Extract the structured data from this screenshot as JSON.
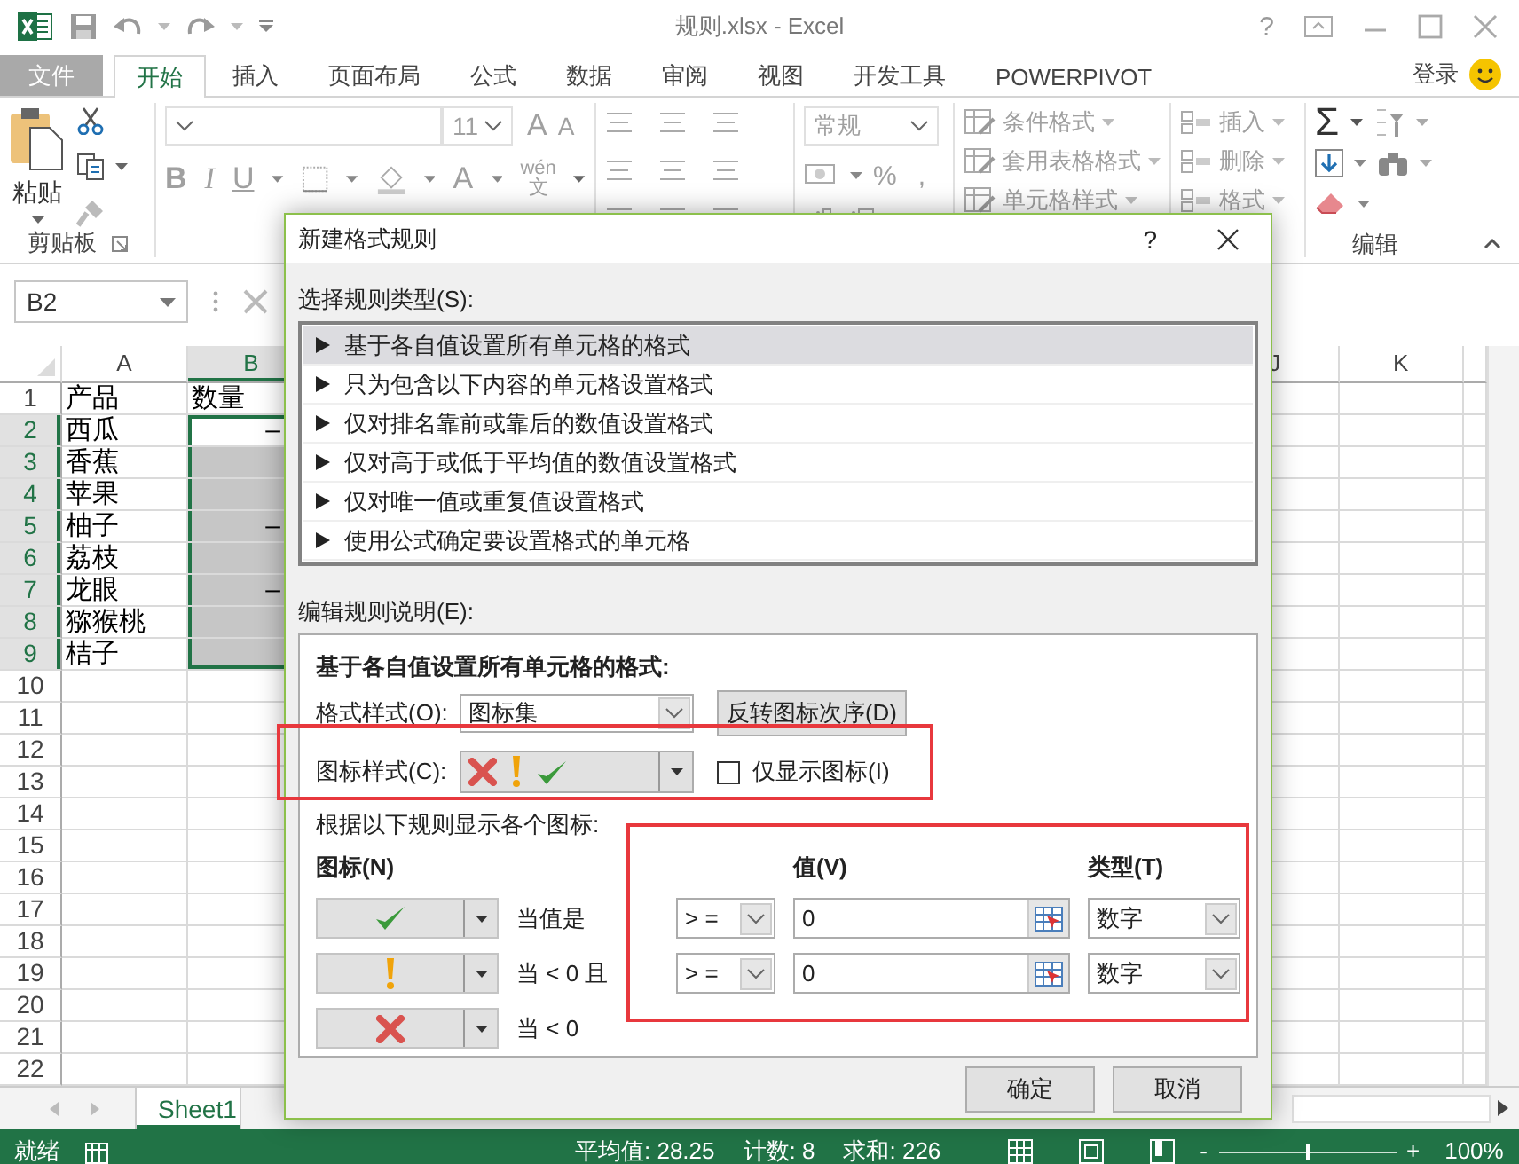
{
  "window": {
    "title": "规则.xlsx - Excel",
    "help": "?"
  },
  "ribbon_tabs": [
    {
      "label": "文件",
      "kind": "file",
      "selected": false
    },
    {
      "label": "开始",
      "kind": "tab",
      "selected": true
    },
    {
      "label": "插入",
      "kind": "tab",
      "selected": false
    },
    {
      "label": "页面布局",
      "kind": "tab",
      "selected": false
    },
    {
      "label": "公式",
      "kind": "tab",
      "selected": false
    },
    {
      "label": "数据",
      "kind": "tab",
      "selected": false
    },
    {
      "label": "审阅",
      "kind": "tab",
      "selected": false
    },
    {
      "label": "视图",
      "kind": "tab",
      "selected": false
    },
    {
      "label": "开发工具",
      "kind": "tab",
      "selected": false
    },
    {
      "label": "POWERPIVOT",
      "kind": "tab",
      "selected": false
    }
  ],
  "account": "登录",
  "ribbon": {
    "paste": "粘贴",
    "clipboard_group": "剪贴板",
    "font_size": "11",
    "grow_font": "A",
    "shrink_font": "A",
    "bold": "B",
    "italic": "I",
    "underline": "U",
    "font_color": "A",
    "phonetic": "wén",
    "phonetic_base": "文",
    "number_format": "常规",
    "percent": "%",
    "comma": ",",
    "styles": [
      "条件格式",
      "套用表格格式",
      "单元格样式"
    ],
    "cells": [
      "插入",
      "删除",
      "格式"
    ],
    "autosum": "Σ",
    "editing_group": "编辑"
  },
  "name_box": "B2",
  "sheet": {
    "columns": [
      {
        "label": "A",
        "selected": false
      },
      {
        "label": "B",
        "selected": true
      }
    ],
    "columns_right": [
      {
        "label": "J",
        "selected": false
      },
      {
        "label": "K",
        "selected": false
      }
    ],
    "rows": [
      {
        "number": "1",
        "selected": false,
        "active": false,
        "cells": [
          {
            "text": "产品",
            "kind": "text"
          },
          {
            "text": "数量",
            "kind": "text"
          }
        ]
      },
      {
        "number": "2",
        "selected": true,
        "active": true,
        "cells": [
          {
            "text": "西瓜",
            "kind": "text"
          },
          {
            "text": "–",
            "kind": "value"
          }
        ]
      },
      {
        "number": "3",
        "selected": true,
        "active": false,
        "cells": [
          {
            "text": "香蕉",
            "kind": "text"
          }
        ]
      },
      {
        "number": "4",
        "selected": true,
        "active": false,
        "cells": [
          {
            "text": "苹果",
            "kind": "text"
          }
        ]
      },
      {
        "number": "5",
        "selected": true,
        "active": false,
        "cells": [
          {
            "text": "柚子",
            "kind": "text"
          },
          {
            "text": "–",
            "kind": "value"
          }
        ]
      },
      {
        "number": "6",
        "selected": true,
        "active": false,
        "cells": [
          {
            "text": "荔枝",
            "kind": "text"
          }
        ]
      },
      {
        "number": "7",
        "selected": true,
        "active": false,
        "cells": [
          {
            "text": "龙眼",
            "kind": "text"
          },
          {
            "text": "–",
            "kind": "value"
          }
        ]
      },
      {
        "number": "8",
        "selected": true,
        "active": false,
        "cells": [
          {
            "text": "猕猴桃",
            "kind": "text"
          }
        ]
      },
      {
        "number": "9",
        "selected": true,
        "active": false,
        "cells": [
          {
            "text": "桔子",
            "kind": "text"
          }
        ]
      },
      {
        "number": "10",
        "selected": false,
        "active": false
      },
      {
        "number": "11",
        "selected": false,
        "active": false
      },
      {
        "number": "12",
        "selected": false,
        "active": false
      },
      {
        "number": "13",
        "selected": false,
        "active": false
      },
      {
        "number": "14",
        "selected": false,
        "active": false
      },
      {
        "number": "15",
        "selected": false,
        "active": false
      },
      {
        "number": "16",
        "selected": false,
        "active": false
      },
      {
        "number": "17",
        "selected": false,
        "active": false
      },
      {
        "number": "18",
        "selected": false,
        "active": false
      },
      {
        "number": "19",
        "selected": false,
        "active": false
      },
      {
        "number": "20",
        "selected": false,
        "active": false
      },
      {
        "number": "21",
        "selected": false,
        "active": false
      },
      {
        "number": "22",
        "selected": false,
        "active": false
      }
    ]
  },
  "sheet_tabs": [
    {
      "label": "Sheet1",
      "selected": true
    }
  ],
  "status_bar": {
    "ready": "就绪",
    "average": "平均值: 28.25",
    "count": "计数: 8",
    "sum": "求和: 226",
    "zoom_out": "-",
    "zoom_in": "+",
    "zoom_slider": {
      "level": 0.5
    },
    "zoom": "100%"
  },
  "dialog": {
    "title": "新建格式规则",
    "help": "?",
    "rule_type_label": "选择规则类型(S):",
    "rule_types": [
      {
        "label": "基于各自值设置所有单元格的格式",
        "selected": true
      },
      {
        "label": "只为包含以下内容的单元格设置格式",
        "selected": false
      },
      {
        "label": "仅对排名靠前或靠后的数值设置格式",
        "selected": false
      },
      {
        "label": "仅对高于或低于平均值的数值设置格式",
        "selected": false
      },
      {
        "label": "仅对唯一值或重复值设置格式",
        "selected": false
      },
      {
        "label": "使用公式确定要设置格式的单元格",
        "selected": false
      }
    ],
    "description_label": "编辑规则说明(E):",
    "panel": {
      "heading": "基于各自值设置所有单元格的格式:",
      "format_style": {
        "label": "格式样式(O):",
        "value": "图标集"
      },
      "reverse_button": "反转图标次序(D)",
      "icon_style": {
        "label": "图标样式(C):",
        "icons": [
          {
            "kind": "cross"
          },
          {
            "kind": "exclamation"
          },
          {
            "kind": "check"
          }
        ]
      },
      "show_icon_only": {
        "label": "仅显示图标(I)",
        "checked": false
      },
      "rules_label": "根据以下规则显示各个图标:",
      "headers": {
        "icon": "图标(N)",
        "value": "值(V)",
        "type": "类型(T)"
      },
      "rules": [
        {
          "kind": "check",
          "condition": "当值是",
          "operator": "> =",
          "value": "0",
          "type": "数字"
        },
        {
          "kind": "exclamation",
          "condition": "当 < 0 且",
          "operator": "> =",
          "value": "0",
          "type": "数字"
        },
        {
          "kind": "cross",
          "condition": "当 < 0"
        }
      ]
    },
    "buttons": [
      "确定",
      "取消"
    ]
  }
}
